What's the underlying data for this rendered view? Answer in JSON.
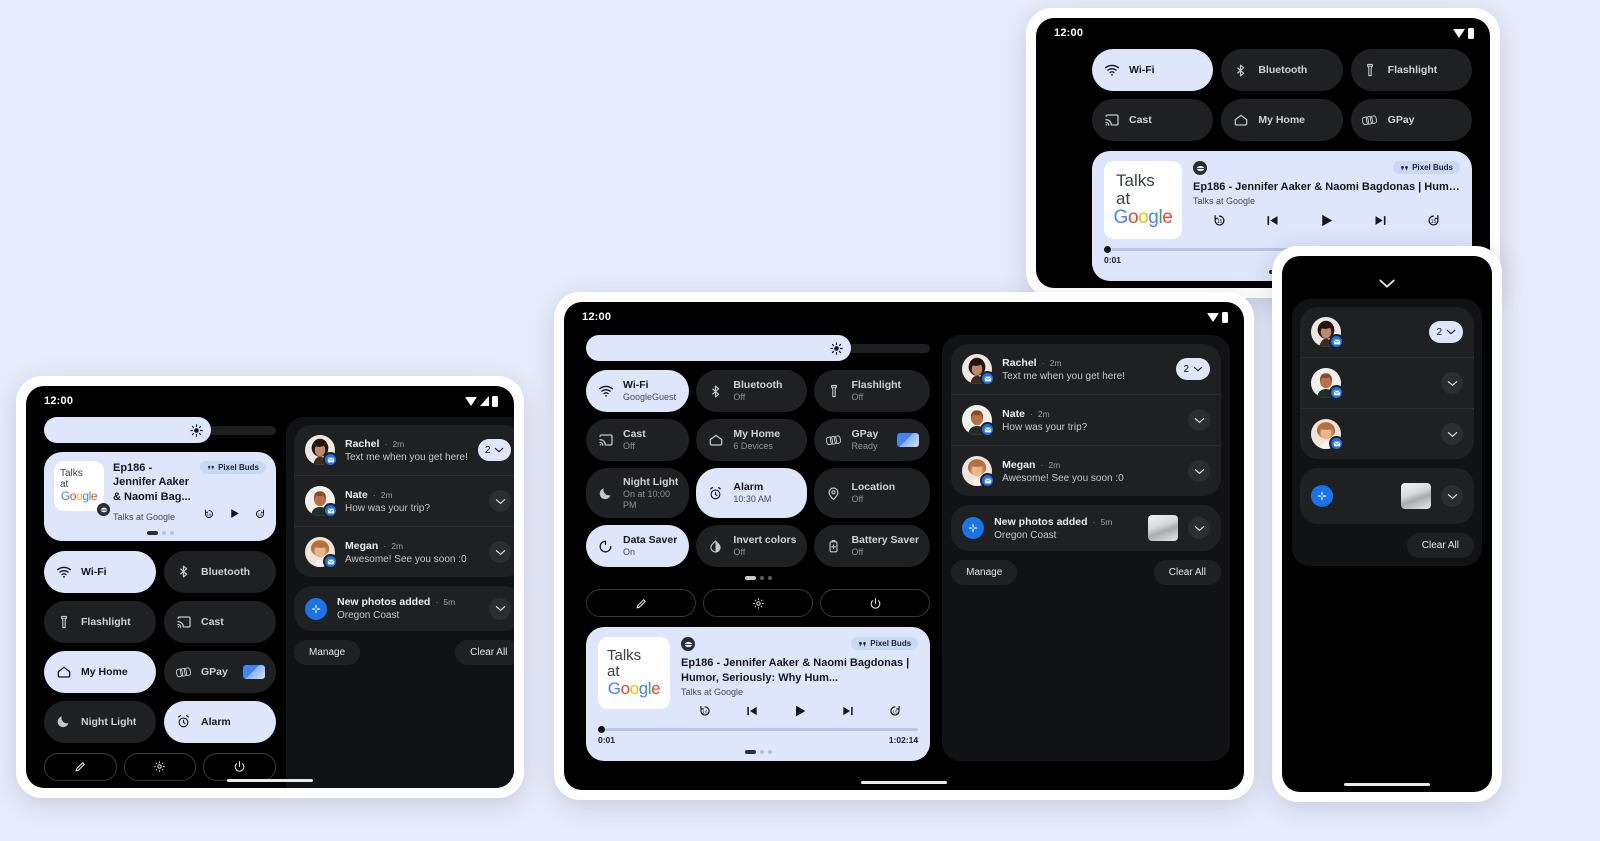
{
  "page": {
    "background": "#e8edfb",
    "accent": "#dde6fb",
    "blue": "#1a73e8"
  },
  "status_bar": {
    "time": "12:00",
    "icons": [
      "wifi-icon",
      "signal-icon",
      "battery-icon"
    ]
  },
  "quick_settings": {
    "brightness": {
      "name": "brightness-slider",
      "icon": "brightness-sun-icon",
      "value_percent": 77
    },
    "tiles_tablet": [
      {
        "label": "Wi-Fi",
        "sub": "GoogleGuest",
        "icon": "wifi-icon",
        "state": "on"
      },
      {
        "label": "Bluetooth",
        "sub": "Off",
        "icon": "bluetooth-icon",
        "state": "off"
      },
      {
        "label": "Flashlight",
        "sub": "Off",
        "icon": "flashlight-icon",
        "state": "off"
      },
      {
        "label": "Cast",
        "sub": "Off",
        "icon": "cast-icon",
        "state": "off"
      },
      {
        "label": "My Home",
        "sub": "6 Devices",
        "icon": "home-icon",
        "state": "off"
      },
      {
        "label": "GPay",
        "sub": "Ready",
        "icon": "gpay-icon",
        "state": "off",
        "extra": "payment-card"
      },
      {
        "label": "Night Light",
        "sub": "On at 10:00 PM",
        "icon": "moon-icon",
        "state": "off"
      },
      {
        "label": "Alarm",
        "sub": "10:30 AM",
        "icon": "alarm-icon",
        "state": "on"
      },
      {
        "label": "Location",
        "sub": "Off",
        "icon": "location-pin-icon",
        "state": "off"
      },
      {
        "label": "Data Saver",
        "sub": "On",
        "icon": "data-saver-icon",
        "state": "on"
      },
      {
        "label": "Invert colors",
        "sub": "Off",
        "icon": "invert-colors-icon",
        "state": "off"
      },
      {
        "label": "Battery Saver",
        "sub": "Off",
        "icon": "battery-saver-icon",
        "state": "off"
      }
    ],
    "tiles_tablet_top": [
      {
        "label": "Wi-Fi",
        "icon": "wifi-icon",
        "state": "on"
      },
      {
        "label": "Bluetooth",
        "icon": "bluetooth-icon",
        "state": "off"
      },
      {
        "label": "Flashlight",
        "icon": "flashlight-icon",
        "state": "off"
      },
      {
        "label": "Cast",
        "icon": "cast-icon",
        "state": "off"
      },
      {
        "label": "My Home",
        "icon": "home-icon",
        "state": "off"
      },
      {
        "label": "GPay",
        "icon": "gpay-icon",
        "state": "off"
      }
    ],
    "tiles_phone": [
      {
        "label": "Wi-Fi",
        "icon": "wifi-icon",
        "state": "on"
      },
      {
        "label": "Bluetooth",
        "icon": "bluetooth-icon",
        "state": "off"
      },
      {
        "label": "Flashlight",
        "icon": "flashlight-icon",
        "state": "off"
      },
      {
        "label": "Cast",
        "icon": "cast-icon",
        "state": "off"
      },
      {
        "label": "My Home",
        "icon": "home-icon",
        "state": "on"
      },
      {
        "label": "GPay",
        "icon": "gpay-icon",
        "state": "off",
        "extra": "payment-card"
      },
      {
        "label": "Night Light",
        "icon": "moon-icon",
        "state": "off"
      },
      {
        "label": "Alarm",
        "icon": "alarm-icon",
        "state": "on"
      }
    ],
    "footer_buttons": [
      {
        "name": "edit-tiles-button",
        "icon": "pencil-icon"
      },
      {
        "name": "settings-button",
        "icon": "gear-icon"
      },
      {
        "name": "power-button",
        "icon": "power-icon"
      }
    ],
    "page_indicator": {
      "pages": 3,
      "active": 1
    }
  },
  "media_player": {
    "app_icon": "podcast-app-icon",
    "album_art": {
      "line1": "Talks",
      "line2": "at",
      "line3": "Google"
    },
    "output_chip": {
      "label": "Pixel Buds",
      "icon": "earbuds-icon"
    },
    "title_full": "Ep186 - Jennifer Aaker & Naomi Bagdonas | Humor, Seriously:...",
    "title_center": "Ep186 - Jennifer Aaker & Naomi Bagdonas | Humor, Seriously: Why Hum...",
    "title_phone": "Ep186 - Jennifer Aaker & Naomi Bag...",
    "subtitle": "Talks at Google",
    "controls": [
      {
        "name": "rewind-15-button",
        "icon": "replay-15-icon",
        "label": "15"
      },
      {
        "name": "previous-track-button",
        "icon": "skip-previous-icon"
      },
      {
        "name": "play-button",
        "icon": "play-icon"
      },
      {
        "name": "next-track-button",
        "icon": "skip-next-icon"
      },
      {
        "name": "forward-15-button",
        "icon": "forward-15-icon",
        "label": "15"
      }
    ],
    "progress": {
      "current": "0:01",
      "total": "1:02:14",
      "percent": 1
    },
    "page_indicator": {
      "pages": 3,
      "active": 1
    }
  },
  "notifications": {
    "messages": [
      {
        "name": "Rachel",
        "time": "2m",
        "message": "Text me when you get here!",
        "avatar": "avatar-rachel",
        "badge": "message-app-badge",
        "count": "2",
        "action": "expand-group"
      },
      {
        "name": "Nate",
        "time": "2m",
        "message": "How was your trip?",
        "avatar": "avatar-nate",
        "badge": "message-app-badge",
        "action": "expand"
      },
      {
        "name": "Megan",
        "time": "2m",
        "message": "Awesome! See you soon :0",
        "avatar": "avatar-megan",
        "badge": "message-app-badge",
        "action": "expand"
      }
    ],
    "photos": {
      "title": "New photos added",
      "time": "5m",
      "subtitle": "Oregon Coast",
      "icon": "photos-app-icon",
      "thumbnail": "photo-thumbnail",
      "action": "expand"
    },
    "separator": "·",
    "footer": {
      "manage": "Manage",
      "clear_all": "Clear All"
    }
  },
  "collapse_handle": {
    "name": "collapse-shade-chevron",
    "icon": "chevron-down-icon"
  }
}
